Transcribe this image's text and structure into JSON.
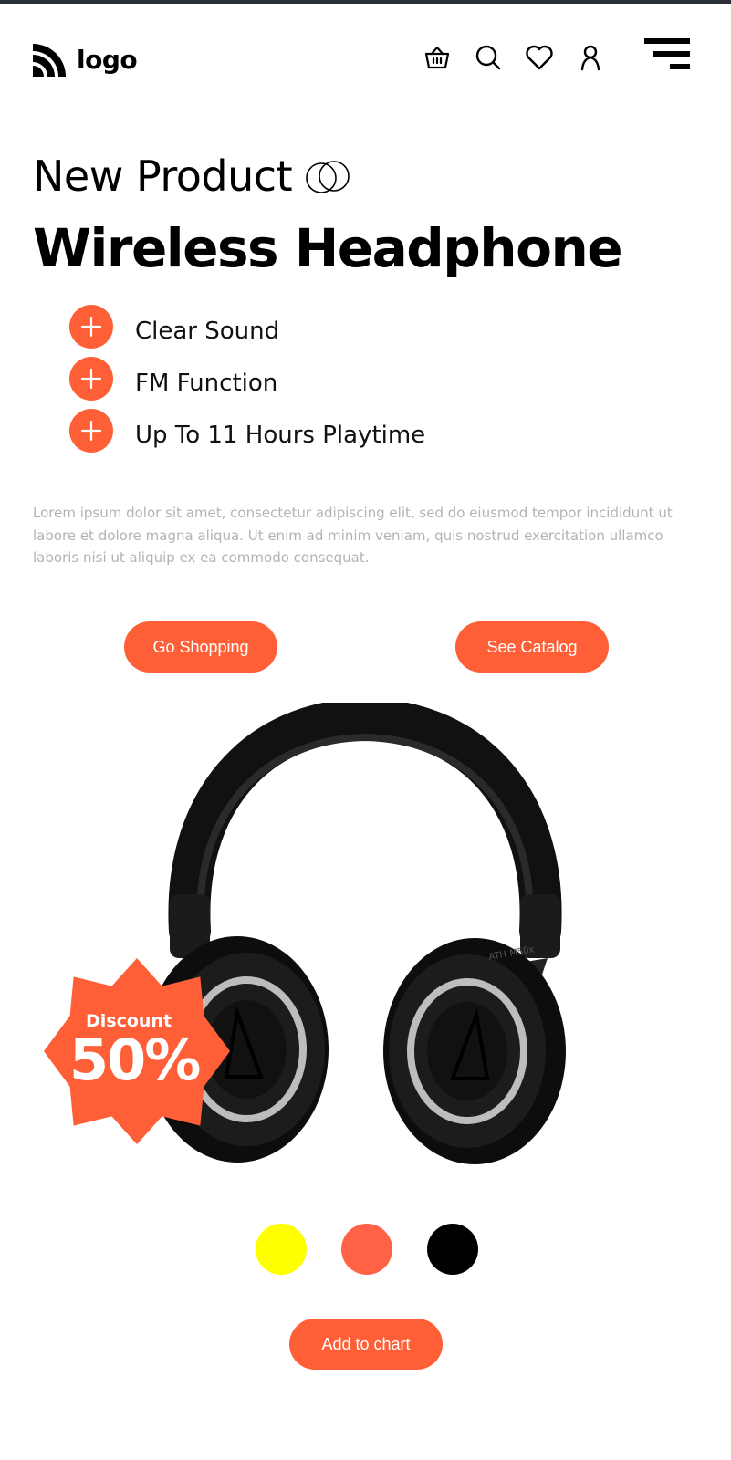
{
  "header": {
    "logo_text": "logo",
    "icons": [
      "basket-icon",
      "search-icon",
      "heart-icon",
      "user-icon",
      "menu-icon"
    ]
  },
  "hero": {
    "kicker": "New Product",
    "title": "Wireless Headphone",
    "features": [
      {
        "label": "Clear Sound"
      },
      {
        "label": "FM Function"
      },
      {
        "label": "Up To 11 Hours Playtime"
      }
    ],
    "description": "Lorem ipsum dolor sit amet, consectetur adipiscing elit, sed do eiusmod tempor incididunt ut labore et dolore magna aliqua. Ut enim ad minim veniam, quis nostrud exercitation ullamco laboris nisi ut aliquip ex ea commodo consequat."
  },
  "buttons": {
    "go_shopping": "Go Shopping",
    "see_catalog": "See Catalog",
    "add_to_chart": "Add to chart"
  },
  "product": {
    "model_label": "ATH-M50x"
  },
  "badge": {
    "label": "Discount",
    "value": "50%"
  },
  "colors": {
    "accent": "#ff5f36",
    "swatches": [
      "#ffff00",
      "#ff6244",
      "#000000"
    ]
  }
}
